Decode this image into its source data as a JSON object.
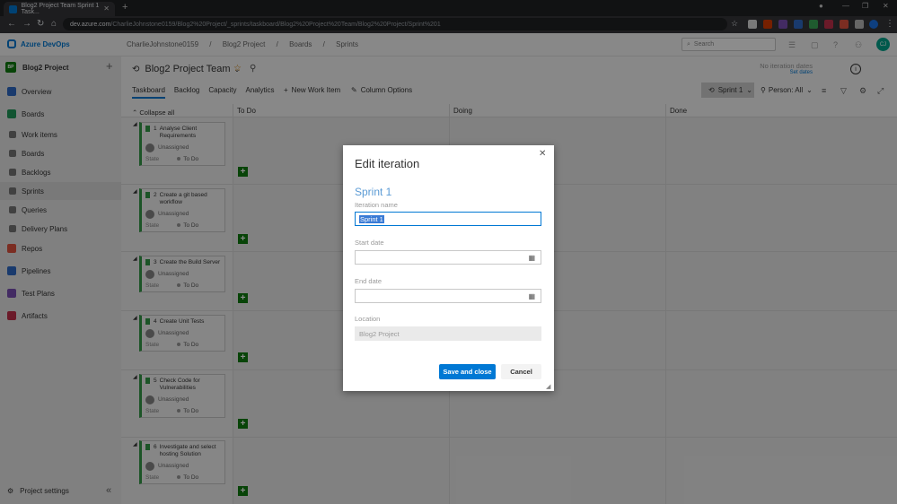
{
  "browser": {
    "tab_title": "Blog2 Project Team Sprint 1 Task...",
    "url_host": "dev.azure.com",
    "url_path": "/CharlieJohnstone0159/Blog2%20Project/_sprints/taskboard/Blog2%20Project%20Team/Blog2%20Project/Sprint%201"
  },
  "header": {
    "brand": "Azure DevOps",
    "breadcrumbs": [
      "CharlieJohnstone0159",
      "/",
      "Blog2 Project",
      "/",
      "Boards",
      "/",
      "Sprints"
    ],
    "search_placeholder": "Search",
    "avatar_initials": "CJ"
  },
  "sidebar": {
    "project_badge": "BP",
    "project_name": "Blog2 Project",
    "items": [
      {
        "label": "Overview",
        "icon": "overview-icon",
        "color": "#2f6bc7"
      },
      {
        "label": "Boards",
        "icon": "boards-icon",
        "color": "#1f9a5a"
      },
      {
        "label": "Work items",
        "icon": "work-items-icon",
        "color": "#555555"
      },
      {
        "label": "Boards",
        "icon": "boards-sub-icon",
        "color": "#555555"
      },
      {
        "label": "Backlogs",
        "icon": "backlogs-icon",
        "color": "#555555"
      },
      {
        "label": "Sprints",
        "icon": "sprints-icon",
        "color": "#555555"
      },
      {
        "label": "Queries",
        "icon": "queries-icon",
        "color": "#555555"
      },
      {
        "label": "Delivery Plans",
        "icon": "delivery-plans-icon",
        "color": "#555555"
      },
      {
        "label": "Repos",
        "icon": "repos-icon",
        "color": "#e0533f"
      },
      {
        "label": "Pipelines",
        "icon": "pipelines-icon",
        "color": "#2f6bc7"
      },
      {
        "label": "Test Plans",
        "icon": "test-plans-icon",
        "color": "#7a4fb5"
      },
      {
        "label": "Artifacts",
        "icon": "artifacts-icon",
        "color": "#c4314b"
      }
    ],
    "project_settings": "Project settings"
  },
  "main": {
    "team_name": "Blog2 Project Team",
    "no_iteration": "No iteration dates",
    "set_dates": "Set dates",
    "tabs": [
      "Taskboard",
      "Backlog",
      "Capacity",
      "Analytics"
    ],
    "new_work_item": "New Work Item",
    "column_options": "Column Options",
    "sprint_selector": "Sprint 1",
    "person_filter": "Person: All",
    "collapse_all": "Collapse all",
    "columns": [
      "To Do",
      "Doing",
      "Done"
    ],
    "cards": [
      {
        "num": "1",
        "title": "Analyse Client Requirements",
        "assignee": "Unassigned",
        "state_label": "State",
        "state": "To Do"
      },
      {
        "num": "2",
        "title": "Create a git based workflow",
        "assignee": "Unassigned",
        "state_label": "State",
        "state": "To Do"
      },
      {
        "num": "3",
        "title": "Create the Build Server",
        "assignee": "Unassigned",
        "state_label": "State",
        "state": "To Do"
      },
      {
        "num": "4",
        "title": "Create Unit Tests",
        "assignee": "Unassigned",
        "state_label": "State",
        "state": "To Do"
      },
      {
        "num": "5",
        "title": "Check Code for Vulnerabilities",
        "assignee": "Unassigned",
        "state_label": "State",
        "state": "To Do"
      },
      {
        "num": "6",
        "title": "Investigate and select hosting Solution",
        "assignee": "Unassigned",
        "state_label": "State",
        "state": "To Do"
      }
    ]
  },
  "dialog": {
    "title": "Edit iteration",
    "sprint_name": "Sprint 1",
    "iteration_name_label": "Iteration name",
    "iteration_name_value": "Sprint 1",
    "start_date_label": "Start date",
    "start_date_value": "",
    "end_date_label": "End date",
    "end_date_value": "",
    "location_label": "Location",
    "location_value": "Blog2 Project",
    "save_label": "Save and close",
    "cancel_label": "Cancel"
  }
}
